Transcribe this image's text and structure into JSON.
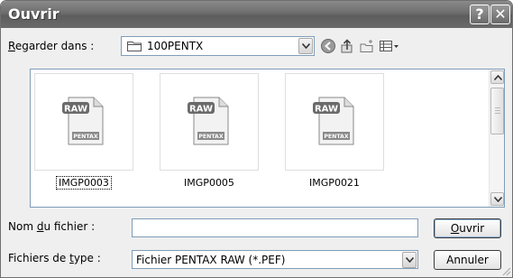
{
  "window": {
    "title": "Ouvrir",
    "help_label": "?",
    "close_label": "✕"
  },
  "lookin": {
    "label_accel": "R",
    "label_rest": "egarder dans :",
    "value": "100PENTX",
    "icon": "folder-icon"
  },
  "toolbar": {
    "icons": [
      "back-icon",
      "up-folder-icon",
      "new-folder-icon",
      "view-menu-icon"
    ]
  },
  "files": [
    {
      "name": "IMGP0003",
      "icon": "pentax-raw-file-icon",
      "focused": true
    },
    {
      "name": "IMGP0005",
      "icon": "pentax-raw-file-icon",
      "focused": false
    },
    {
      "name": "IMGP0021",
      "icon": "pentax-raw-file-icon",
      "focused": false
    }
  ],
  "file_icon_text": {
    "top": "RAW",
    "bottom": "PENTAX"
  },
  "filename": {
    "label_pre": "Nom ",
    "label_accel": "d",
    "label_post": "u fichier :",
    "value": ""
  },
  "filetype": {
    "label_pre": "Fichiers de ",
    "label_accel": "t",
    "label_post": "ype :",
    "value": "Fichier PENTAX RAW (*.PEF)"
  },
  "buttons": {
    "open_accel": "O",
    "open_rest": "uvrir",
    "cancel": "Annuler"
  },
  "colors": {
    "titlebar": "#6d6d6d",
    "field_border": "#7f9db9",
    "dialog_bg": "#efefef"
  }
}
